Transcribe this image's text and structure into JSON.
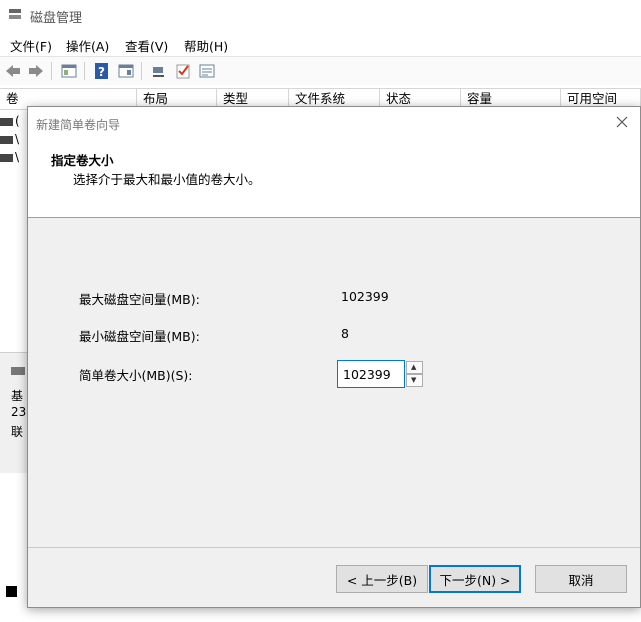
{
  "app": {
    "title": "磁盘管理",
    "menu": [
      "文件(F)",
      "操作(A)",
      "查看(V)",
      "帮助(H)"
    ],
    "columns": [
      "卷",
      "布局",
      "类型",
      "文件系统",
      "状态",
      "容量",
      "可用空间"
    ],
    "row_fragments": [
      "(",
      "\\",
      "\\"
    ],
    "lower_fragments": [
      "基",
      "23",
      "联"
    ]
  },
  "dialog": {
    "title": "新建简单卷向导",
    "heading": "指定卷大小",
    "subheading": "选择介于最大和最小值的卷大小。",
    "fields": {
      "max_label": "最大磁盘空间量(MB):",
      "max_value": "102399",
      "min_label": "最小磁盘空间量(MB):",
      "min_value": "8",
      "size_label": "简单卷大小(MB)(S):",
      "size_value": "102399"
    },
    "buttons": {
      "back": "< 上一步(B)",
      "next": "下一步(N) >",
      "cancel": "取消"
    }
  },
  "colors": {
    "accent": "#0078d7",
    "dialog_bg": "#f0f0f0"
  }
}
